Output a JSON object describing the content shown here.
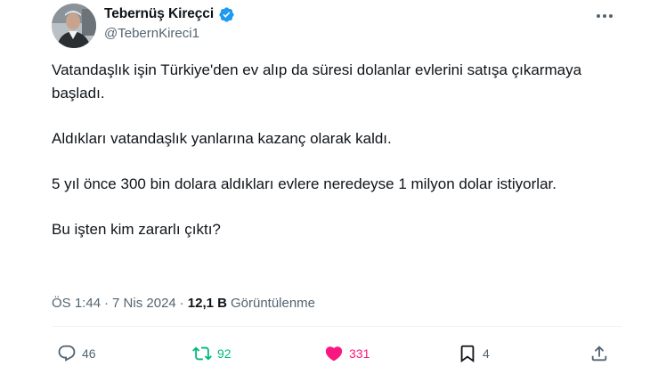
{
  "author": {
    "display_name": "Tebernüş Kireçci",
    "handle": "@TebernKireci1",
    "verified": true
  },
  "tweet": {
    "paragraphs": [
      "Vatandaşlık işin Türkiye'den ev alıp da süresi dolanlar evlerini satışa çıkarmaya başladı.",
      "Aldıkları vatandaşlık yanlarına kazanç olarak kaldı.",
      "5 yıl önce 300 bin dolara aldıkları evlere neredeyse 1 milyon dolar istiyorlar.",
      "Bu işten kim zararlı çıktı?"
    ]
  },
  "meta": {
    "time": "ÖS 1:44",
    "separator": "·",
    "date": "7 Nis 2024",
    "views_count": "12,1 B",
    "views_label": "Görüntülenme"
  },
  "actions": {
    "reply_count": "46",
    "repost_count": "92",
    "like_count": "331",
    "bookmark_count": "4"
  },
  "colors": {
    "text": "#0f1419",
    "secondary": "#536471",
    "verified": "#1d9bf0",
    "repost_active": "#00ba7c",
    "like_active": "#f91880"
  },
  "icons": [
    "verified-badge-icon",
    "more-icon",
    "reply-icon",
    "repost-icon",
    "like-icon",
    "bookmark-icon",
    "share-icon"
  ]
}
